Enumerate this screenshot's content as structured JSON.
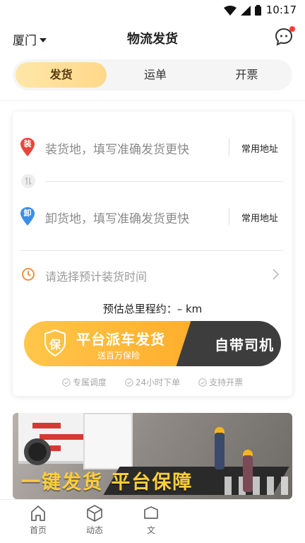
{
  "status_bar": {
    "time": "10:17"
  },
  "nav": {
    "city": "厦门",
    "title": "物流发货"
  },
  "tabs": [
    {
      "label": "发货",
      "active": true
    },
    {
      "label": "运单",
      "active": false
    },
    {
      "label": "开票",
      "active": false
    }
  ],
  "form": {
    "load": {
      "badge": "装",
      "placeholder": "装货地，填写准确发货更快",
      "common_label": "常用地址"
    },
    "unload": {
      "badge": "卸",
      "placeholder": "卸货地，填写准确发货更快",
      "common_label": "常用地址"
    },
    "time_placeholder": "请选择预计装货时间",
    "estimate_label": "预估总里程约：",
    "estimate_value": "– km"
  },
  "dispatch_button": {
    "shield_char": "保",
    "title": "平台派车发货",
    "subtitle": "送百万保险",
    "own_driver": "自带司机"
  },
  "features": [
    "专属调度",
    "24小时下单",
    "支持开票"
  ],
  "banner": {
    "text": "一键发货  平台保障"
  },
  "bottom_nav": [
    {
      "label": "首页",
      "icon": "home-icon"
    },
    {
      "label": "动态",
      "icon": "cube-icon"
    },
    {
      "label": "文",
      "icon": "box-icon"
    }
  ],
  "colors": {
    "accent": "#ffc64a",
    "dark_button": "#3d3d3d",
    "load_pin": "#e8453c",
    "unload_pin": "#3a8ee6",
    "clock": "#f08a2c",
    "unread_dot": "#ff3b30"
  }
}
